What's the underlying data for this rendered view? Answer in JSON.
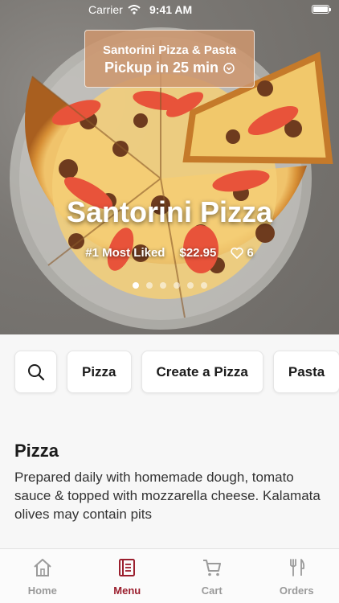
{
  "status_bar": {
    "carrier": "Carrier",
    "time": "9:41 AM"
  },
  "hero": {
    "pickup_line1": "Santorini Pizza & Pasta",
    "pickup_line2": "Pickup in 25 min",
    "title": "Santorini Pizza",
    "badge": "#1 Most Liked",
    "price": "$22.95",
    "likes": "6",
    "carousel_dots": 6,
    "active_dot": 0
  },
  "categories": [
    {
      "label": "Pizza"
    },
    {
      "label": "Create a Pizza"
    },
    {
      "label": "Pasta"
    }
  ],
  "section": {
    "title": "Pizza",
    "description": "Prepared daily with homemade dough, tomato sauce & topped with mozzarella cheese. Kalamata olives may contain pits"
  },
  "tabs": [
    {
      "label": "Home",
      "icon": "home-icon",
      "active": false
    },
    {
      "label": "Menu",
      "icon": "menu-icon",
      "active": true
    },
    {
      "label": "Cart",
      "icon": "cart-icon",
      "active": false
    },
    {
      "label": "Orders",
      "icon": "utensils-icon",
      "active": false
    }
  ],
  "colors": {
    "accent": "#9b1f2e",
    "pickup_bg": "#cd966e",
    "inactive_tab": "#9a9a9a"
  }
}
